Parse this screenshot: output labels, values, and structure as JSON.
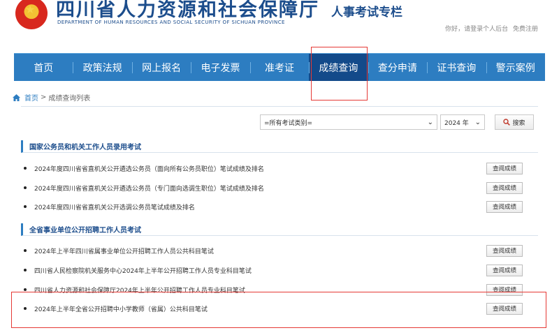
{
  "header": {
    "title": "四川省人力资源和社会保障厅",
    "subtitle": "DEPARTMENT OF HUMAN RESOURCES AND SOCIAL SECURITY OF SICHUAN PROVINCE",
    "exam_title": "人事考试专栏",
    "greeting": "你好，请登录个人后台",
    "register": "免费注册"
  },
  "nav": {
    "items": [
      "首页",
      "政策法规",
      "网上报名",
      "电子发票",
      "准考证",
      "成绩查询",
      "查分申请",
      "证书查询",
      "警示案例"
    ],
    "active_index": 5
  },
  "breadcrumb": {
    "home": "首页",
    "separator": ">",
    "current": "成绩查询列表"
  },
  "filter": {
    "category": "=所有考试类别=",
    "year": "2024 年",
    "search_label": "搜索"
  },
  "sections": [
    {
      "title": "国家公务员和机关工作人员录用考试",
      "rows": [
        "2024年度四川省省直机关公开遴选公务员（面向所有公务员职位）笔试成绩及排名",
        "2024年度四川省省直机关公开遴选公务员（专门面向选调生职位）笔试成绩及排名",
        "2024年度四川省省直机关公开选调公务员笔试成绩及排名"
      ]
    },
    {
      "title": "全省事业单位公开招聘工作人员考试",
      "rows": [
        "2024年上半年四川省属事业单位公开招聘工作人员公共科目笔试",
        "四川省人民检察院机关服务中心2024年上半年公开招聘工作人员专业科目笔试",
        "四川省人力资源和社会保障厅2024年上半年公开招聘工作人员专业科目笔试",
        "2024年上半年全省公开招聘中小学教师（省属）公共科目笔试"
      ]
    }
  ],
  "row_button_label": "查阅成绩",
  "colors": {
    "nav": "#2d7dc1",
    "nav_active": "#134a8a",
    "brand": "#1c4d8c",
    "highlight": "#e53935"
  }
}
